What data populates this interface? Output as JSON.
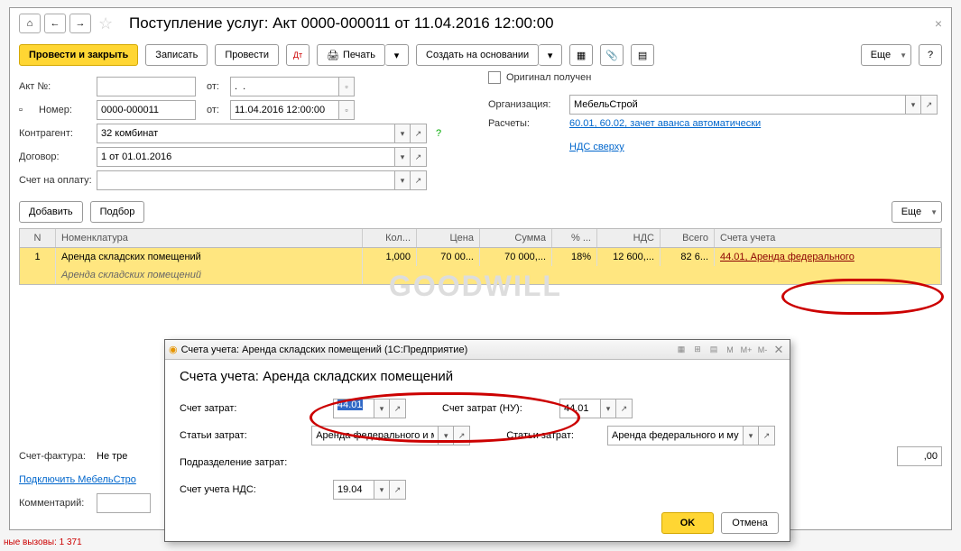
{
  "title": "Поступление услуг: Акт 0000-000011 от 11.04.2016 12:00:00",
  "toolbar": {
    "post_close": "Провести и закрыть",
    "save": "Записать",
    "post": "Провести",
    "print": "Печать",
    "create_based": "Создать на основании",
    "more": "Еще"
  },
  "form": {
    "akt_label": "Акт №:",
    "from_label": "от:",
    "akt_no": "",
    "akt_date": ".  .",
    "number_label": "Номер:",
    "number": "0000-000011",
    "date": "11.04.2016 12:00:00",
    "contragent_label": "Контрагент:",
    "contragent": "32 комбинат",
    "contract_label": "Договор:",
    "contract": "1 от 01.01.2016",
    "invoice_label": "Счет на оплату:",
    "original_label": "Оригинал получен",
    "org_label": "Организация:",
    "org": "МебельСтрой",
    "calc_label": "Расчеты:",
    "calc_link": "60.01, 60.02, зачет аванса автоматически",
    "nds_link": "НДС сверху"
  },
  "table_toolbar": {
    "add": "Добавить",
    "pick": "Подбор",
    "more": "Еще"
  },
  "table": {
    "headers": {
      "n": "N",
      "nom": "Номенклатура",
      "qty": "Кол...",
      "price": "Цена",
      "sum": "Сумма",
      "pct": "% ...",
      "nds": "НДС",
      "total": "Всего",
      "acct": "Счета учета"
    },
    "row": {
      "n": "1",
      "nom": "Аренда складских помещений",
      "nom2": "Аренда складских помещений",
      "qty": "1,000",
      "price": "70 00...",
      "sum": "70 000,...",
      "pct": "18%",
      "nds": "12 600,...",
      "total": "82 6...",
      "acct": "44.01, Аренда федерального"
    }
  },
  "bottom": {
    "sf_label": "Счет-фактура:",
    "sf_value": "Не тре",
    "connect": "Подключить МебельСтро",
    "comment_label": "Комментарий:",
    "total_value": ",00"
  },
  "status": "ные вызовы: 1 371",
  "watermark": "GOODWILL",
  "dialog": {
    "wintitle": "Счета учета: Аренда складских помещений  (1С:Предприятие)",
    "title": "Счета учета: Аренда складских помещений",
    "cost_acct_label": "Счет затрат:",
    "cost_acct": "44.01",
    "cost_item_label": "Статьи затрат:",
    "cost_item": "Аренда федерального и мун",
    "dept_label": "Подразделение затрат:",
    "nds_acct_label": "Счет учета НДС:",
    "nds_acct": "19.04",
    "cost_acct_nu_label": "Счет затрат (НУ):",
    "cost_acct_nu": "44.01",
    "cost_item2_label": "Статьи затрат:",
    "cost_item2": "Аренда федерального и муни",
    "ok": "OK",
    "cancel": "Отмена"
  }
}
